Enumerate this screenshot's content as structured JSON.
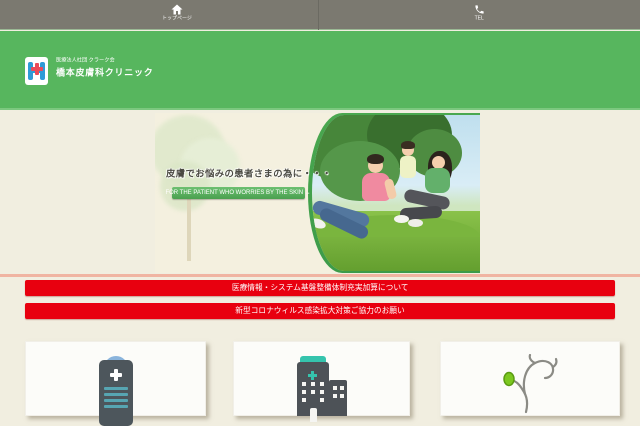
{
  "topbar": {
    "home_label": "トップページ",
    "tel_label": "TEL"
  },
  "header": {
    "org": "医療法人社団 クラーク会",
    "clinic_name": "橋本皮膚科クリニック"
  },
  "hero": {
    "title": "皮膚でお悩みの患者さまの為に・・・",
    "tagline": "FOR THE PATIENT WHO WORRIES BY THE SKIN →"
  },
  "notices": [
    {
      "label": "医療情報・システム基盤整備体制充実加算について"
    },
    {
      "label": "新型コロナウィルス感染拡大対策ご協力のお願い"
    }
  ],
  "cards": [
    {
      "icon": "medical-chart-icon"
    },
    {
      "icon": "hospital-building-icon"
    },
    {
      "icon": "stethoscope-icon"
    }
  ],
  "colors": {
    "topbar_gray": "#7b7970",
    "header_green": "#57b65e",
    "notice_red": "#e8000f",
    "page_bg": "#f1eee0",
    "icon_teal": "#35c4ad",
    "icon_slate": "#4d565c"
  }
}
